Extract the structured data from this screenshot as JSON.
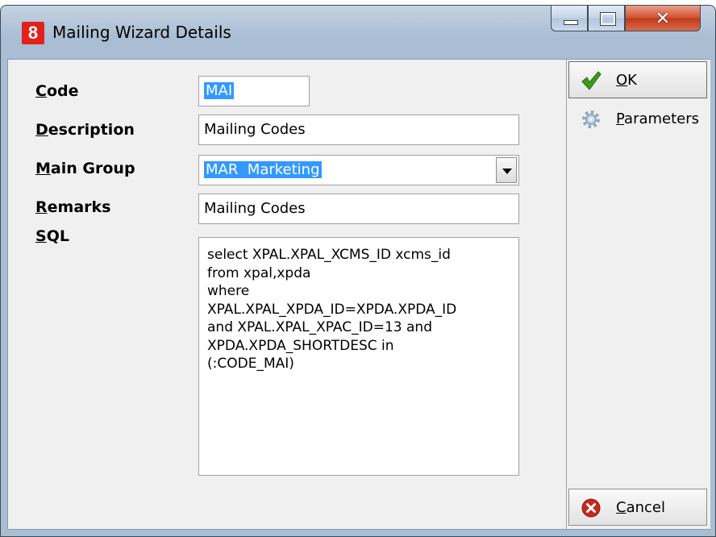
{
  "window": {
    "app_icon_text": "8",
    "title": "Mailing Wizard Details"
  },
  "form": {
    "code": {
      "label_hotkey": "C",
      "label_rest": "ode",
      "value": "MAI"
    },
    "description": {
      "label_hotkey": "D",
      "label_rest": "escription",
      "value": "Mailing Codes"
    },
    "main_group": {
      "label_hotkey": "M",
      "label_rest": "ain Group",
      "value": "MAR  Marketing"
    },
    "remarks": {
      "label_hotkey": "R",
      "label_rest": "emarks",
      "value": "Mailing Codes"
    },
    "sql": {
      "label_hotkey": "S",
      "label_rest": "QL",
      "lines": [
        "select XPAL.XPAL_XCMS_ID xcms_id",
        "from xpal,xpda",
        "where",
        "XPAL.XPAL_XPDA_ID=XPDA.XPDA_ID",
        "and XPAL.XPAL_XPAC_ID=13 and",
        "XPDA.XPDA_SHORTDESC in",
        "(:CODE_MAI)"
      ]
    }
  },
  "buttons": {
    "ok": {
      "hotkey": "O",
      "rest": "K",
      "icon": "checkmark-icon"
    },
    "parameters": {
      "hotkey": "P",
      "rest": "arameters",
      "icon": "gear-icon"
    },
    "cancel": {
      "hotkey": "C",
      "rest": "ancel",
      "icon": "cancel-icon"
    }
  },
  "colors": {
    "selection": "#3399ff",
    "check_green": "#3c9a1c",
    "cancel_red": "#c8281e",
    "app_icon_red": "#e3201b"
  }
}
